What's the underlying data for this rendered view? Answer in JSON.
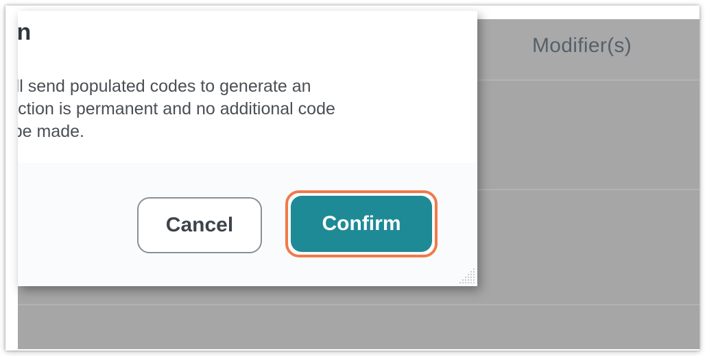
{
  "background_table": {
    "column_header": "Modifier(s)"
  },
  "dialog": {
    "title": "ction",
    "body_lines": [
      "Submitting will send populated codes to generate an",
      "This action is permanent and no additional code",
      "changes can be made."
    ],
    "cancel_label": "Cancel",
    "confirm_label": "Confirm"
  },
  "colors": {
    "confirm_bg": "#1e8a96",
    "highlight_ring": "#f07a4a",
    "overlay": "#a6a6a6"
  },
  "icons": {
    "resize_grip": "resize-grip-icon"
  }
}
